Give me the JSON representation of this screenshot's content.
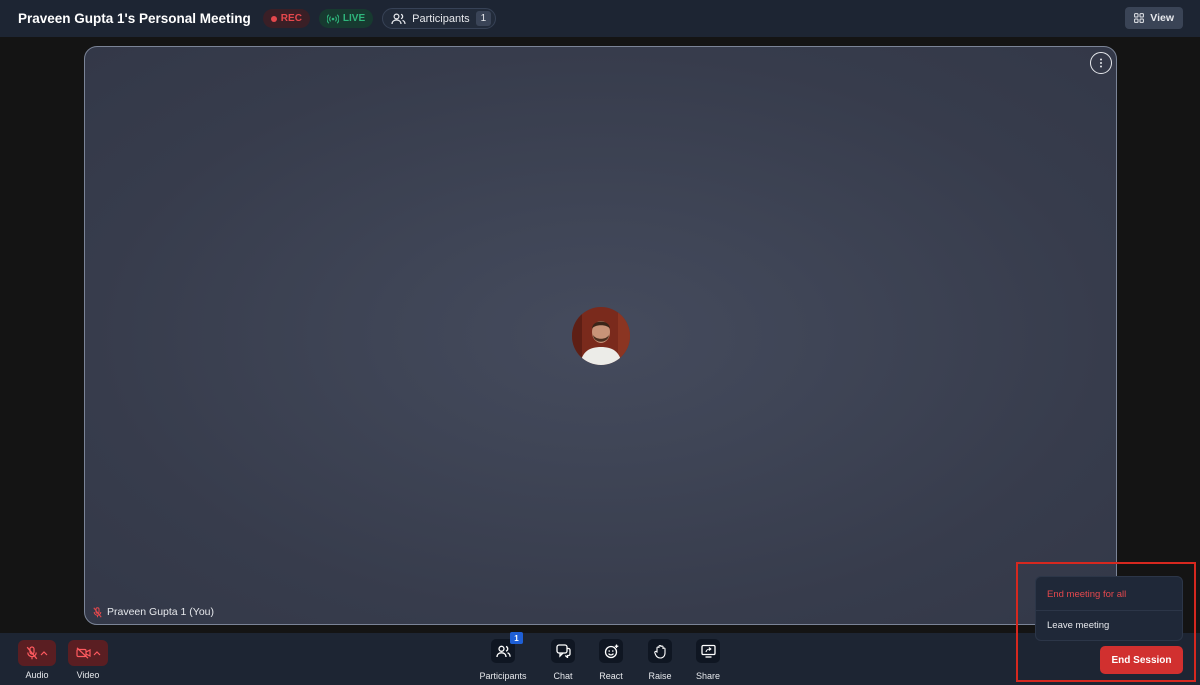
{
  "header": {
    "title": "Praveen Gupta 1's Personal Meeting",
    "rec_label": "REC",
    "live_label": "LIVE",
    "participants_label": "Participants",
    "participants_count": "1",
    "view_label": "View"
  },
  "stage": {
    "participant_name": "Praveen Gupta 1 (You)"
  },
  "controls": {
    "audio_label": "Audio",
    "video_label": "Video",
    "participants_label": "Participants",
    "participants_badge": "1",
    "chat_label": "Chat",
    "react_label": "React",
    "raise_label": "Raise",
    "share_label": "Share"
  },
  "end_menu": {
    "end_for_all": "End meeting for all",
    "leave": "Leave meeting",
    "end_session": "End Session"
  },
  "colors": {
    "danger": "#e5484d",
    "live": "#2fb67c",
    "end_button": "#d1302f",
    "badge_blue": "#1e5fd6",
    "highlight": "#d6281f"
  }
}
